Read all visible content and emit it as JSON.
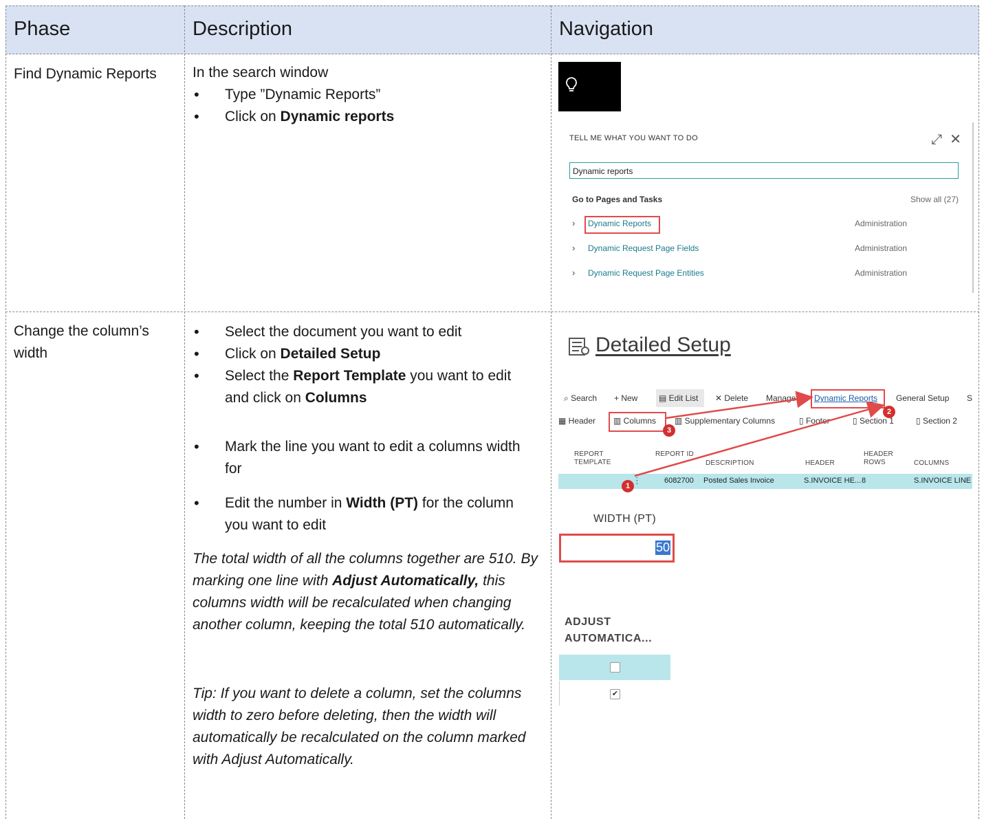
{
  "table": {
    "headers": [
      "Phase",
      "Description",
      "Navigation"
    ],
    "row1": {
      "phase": "Find Dynamic Reports",
      "description_intro": "In the search window",
      "bullet1": "Type ”Dynamic Reports”",
      "bullet2_prefix": "Click on ",
      "bullet2_bold": "Dynamic reports"
    },
    "row2": {
      "phase": "Change the column’s width",
      "b1": "Select the document you want to edit",
      "b2_prefix": "Click on ",
      "b2_bold": "Detailed Setup",
      "b3_prefix": "Select the ",
      "b3_bold": "Report Template",
      "b3_mid": " you want to edit and click on ",
      "b3_bold2": "Columns",
      "b4": "Mark the line you want to edit a columns width for",
      "b5_prefix": "Edit the number in ",
      "b5_bold": "Width (PT)",
      "b5_suffix": " for the column you want to edit",
      "note_prefix": "The total width of all the columns together are 510. By marking one line with ",
      "note_bold": "Adjust Automatically,",
      "note_suffix": " this columns width will be recalculated when changing another column, keeping the total 510 automatically.",
      "tip": "Tip: If you want to delete a column, set the columns width to zero before deleting, then the width will automatically be recalculated on the column marked with Adjust Automatically."
    }
  },
  "search_panel": {
    "title": "TELL ME WHAT YOU WANT TO DO",
    "input_value": "Dynamic reports",
    "section": "Go to Pages and Tasks",
    "show_all": "Show all (27)",
    "results": [
      {
        "label": "Dynamic Reports",
        "category": "Administration"
      },
      {
        "label": "Dynamic Request Page Fields",
        "category": "Administration"
      },
      {
        "label": "Dynamic Request Page Entities",
        "category": "Administration"
      }
    ]
  },
  "detailed_setup": {
    "title": "Detailed Setup",
    "toolbar1": [
      "Search",
      "New",
      "Edit List",
      "Delete",
      "Manage",
      "Dynamic Reports",
      "General Setup",
      "S"
    ],
    "toolbar2": [
      "Header",
      "Columns",
      "Supplementary Columns",
      "Footer",
      "Section 1",
      "Section 2"
    ],
    "columns": [
      "REPORT TEMPLATE",
      "REPORT ID",
      "DESCRIPTION",
      "HEADER",
      "HEADER ROWS",
      "COLUMNS"
    ],
    "row": {
      "report_id": "6082700",
      "description": "Posted Sales Invoice",
      "header": "S.INVOICE HE...",
      "header_rows": "8",
      "columns": "S.INVOICE LINE"
    },
    "badges": [
      "1",
      "2",
      "3"
    ],
    "width_label": "WIDTH (PT)",
    "width_value": "50",
    "adjust_label_1": "ADJUST",
    "adjust_label_2": "AUTOMATICA..."
  },
  "colors": {
    "header_bg": "#d9e2f3",
    "highlight_row": "#b8e6ea",
    "callout_red": "#e04a4a",
    "link_teal": "#1a7a8c"
  }
}
